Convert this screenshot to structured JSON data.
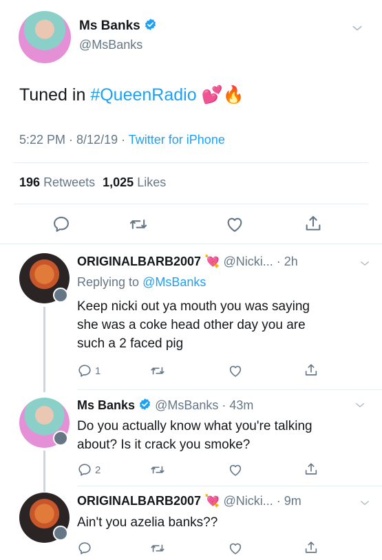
{
  "main_tweet": {
    "name": "Ms Banks",
    "handle": "@MsBanks",
    "text_prefix": "Tuned in ",
    "hashtag": "#QueenRadio",
    "emoji": "💕🔥",
    "time": "5:22 PM · 8/12/19 ·",
    "source": "Twitter for iPhone",
    "retweets_count": "196",
    "retweets_label": "Retweets",
    "likes_count": "1,025",
    "likes_label": "Likes"
  },
  "replies": [
    {
      "name": "ORIGINALBARB2007",
      "emoji": "💘",
      "handle": "@Nicki...",
      "time": "· 2h",
      "replying_prefix": "Replying to ",
      "replying_handle": "@MsBanks",
      "lines": [
        "Keep nicki out ya mouth you was saying",
        "she was a coke head other day you are",
        "such a 2 faced pig"
      ],
      "reply_count": "1"
    },
    {
      "name": "Ms Banks",
      "handle": "@MsBanks",
      "time": "· 43m",
      "lines": [
        "Do you actually know what you're talking",
        "about? Is it crack you smoke?"
      ],
      "reply_count": "2"
    },
    {
      "name": "ORIGINALBARB2007",
      "emoji": "💘",
      "handle": "@Nicki...",
      "time": "· 9m",
      "lines": [
        "Ain't you azelia banks??"
      ],
      "reply_count": ""
    }
  ],
  "colors": {
    "link": "#1da1f2",
    "gray": "#657786",
    "divider": "#e6ecf0"
  },
  "icons": [
    "verified-icon",
    "chevron-down-icon",
    "reply-icon",
    "retweet-icon",
    "like-icon",
    "share-icon"
  ]
}
